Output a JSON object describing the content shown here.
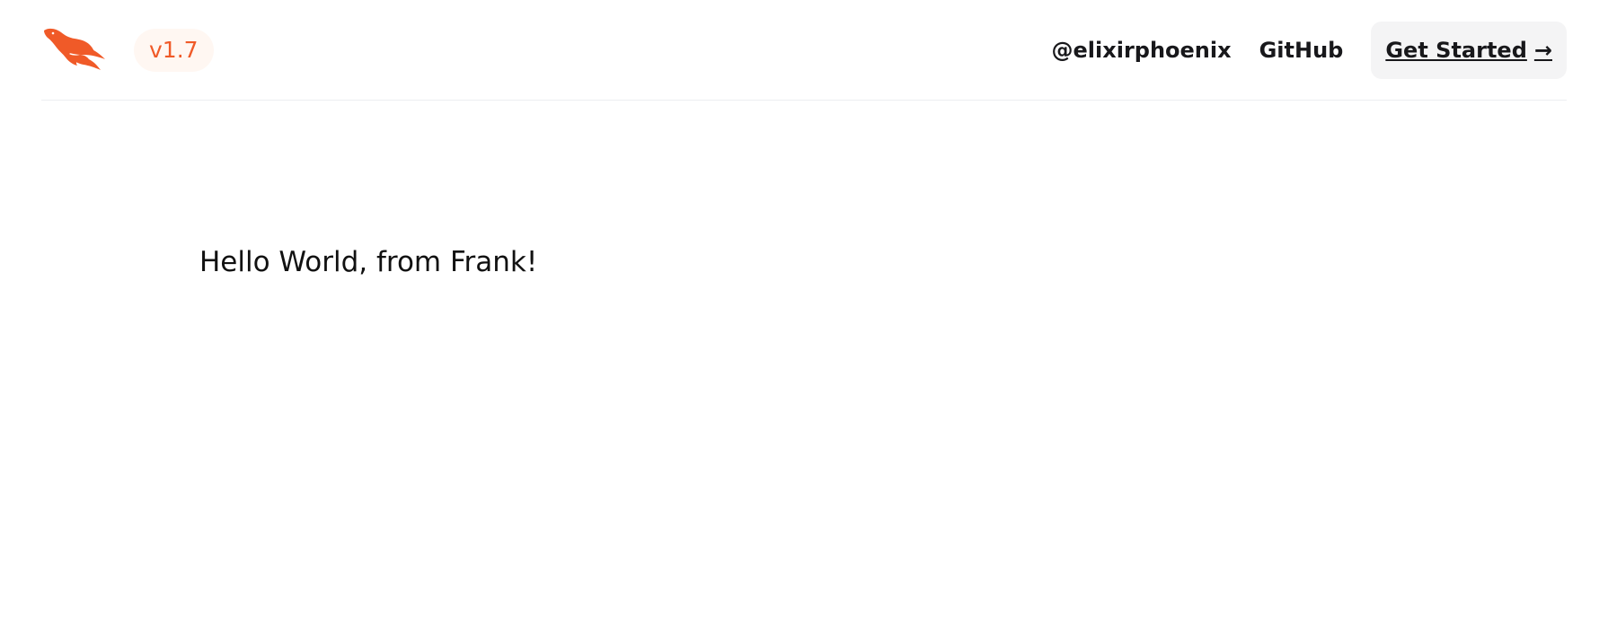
{
  "header": {
    "logo_icon": "phoenix-logo-icon",
    "version": "v1.7",
    "nav": {
      "twitter": "@elixirphoenix",
      "github": "GitHub",
      "get_started": "Get Started",
      "get_started_arrow": "→"
    }
  },
  "main": {
    "greeting": "Hello World, from Frank!"
  },
  "colors": {
    "brand": "#f05a28",
    "version_bg": "#fff7f2",
    "button_bg": "#f4f4f5",
    "text": "#18181b"
  }
}
